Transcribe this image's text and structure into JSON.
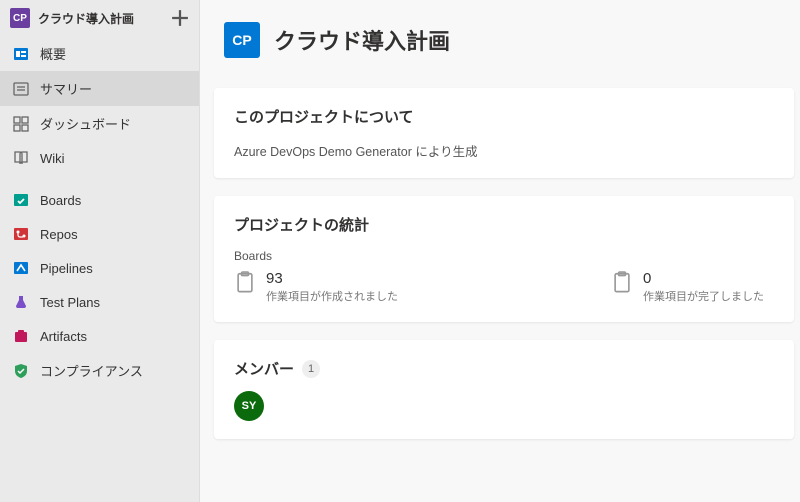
{
  "sidebar": {
    "project_badge": "CP",
    "project_name": "クラウド導入計画",
    "items": [
      {
        "label": "概要"
      },
      {
        "label": "サマリー"
      },
      {
        "label": "ダッシュボード"
      },
      {
        "label": "Wiki"
      },
      {
        "label": "Boards"
      },
      {
        "label": "Repos"
      },
      {
        "label": "Pipelines"
      },
      {
        "label": "Test Plans"
      },
      {
        "label": "Artifacts"
      },
      {
        "label": "コンプライアンス"
      }
    ]
  },
  "header": {
    "badge": "CP",
    "title": "クラウド導入計画"
  },
  "about": {
    "heading": "このプロジェクトについて",
    "body": "Azure DevOps Demo Generator により生成"
  },
  "stats": {
    "heading": "プロジェクトの統計",
    "section_label": "Boards",
    "created": {
      "value": "93",
      "label": "作業項目が作成されました"
    },
    "completed": {
      "value": "0",
      "label": "作業項目が完了しました"
    }
  },
  "members": {
    "heading": "メンバー",
    "count": "1",
    "list": [
      {
        "initials": "SY"
      }
    ]
  }
}
